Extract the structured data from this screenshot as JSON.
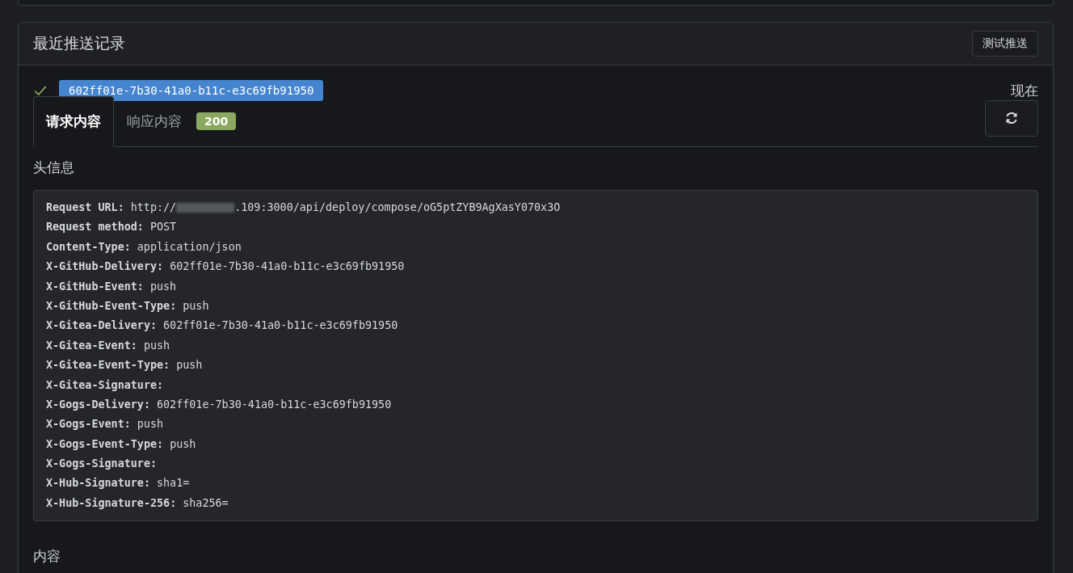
{
  "card": {
    "title": "最近推送记录",
    "test_button": "测试推送"
  },
  "delivery": {
    "success": true,
    "id": "602ff01e-7b30-41a0-b11c-e3c69fb91950",
    "time": "现在"
  },
  "tabs": [
    {
      "label": "请求内容",
      "selected": true
    },
    {
      "label": "响应内容",
      "selected": false,
      "badge": "200"
    }
  ],
  "headers_title": "头信息",
  "headers": [
    {
      "name": "Request URL:",
      "value": "http://",
      "redacted": true,
      "value_suffix": ".109:3000/api/deploy/compose/oG5ptZYB9AgXasY070x3O"
    },
    {
      "name": "Request method:",
      "value": "POST"
    },
    {
      "name": "Content-Type:",
      "value": "application/json"
    },
    {
      "name": "X-GitHub-Delivery:",
      "value": "602ff01e-7b30-41a0-b11c-e3c69fb91950"
    },
    {
      "name": "X-GitHub-Event:",
      "value": "push"
    },
    {
      "name": "X-GitHub-Event-Type:",
      "value": "push"
    },
    {
      "name": "X-Gitea-Delivery:",
      "value": "602ff01e-7b30-41a0-b11c-e3c69fb91950"
    },
    {
      "name": "X-Gitea-Event:",
      "value": "push"
    },
    {
      "name": "X-Gitea-Event-Type:",
      "value": "push"
    },
    {
      "name": "X-Gitea-Signature:"
    },
    {
      "name": "X-Gogs-Delivery:",
      "value": "602ff01e-7b30-41a0-b11c-e3c69fb91950"
    },
    {
      "name": "X-Gogs-Event:",
      "value": "push"
    },
    {
      "name": "X-Gogs-Event-Type:",
      "value": "push"
    },
    {
      "name": "X-Gogs-Signature:"
    },
    {
      "name": "X-Hub-Signature:",
      "value": "sha1="
    },
    {
      "name": "X-Hub-Signature-256:",
      "value": "sha256="
    }
  ],
  "content_title": "内容"
}
